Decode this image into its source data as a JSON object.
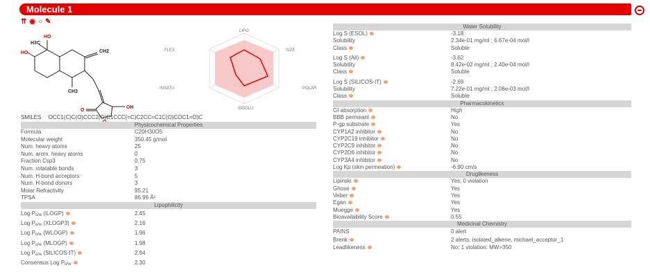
{
  "title": "Molecule 1",
  "toolbar": {
    "icons": [
      "hydrogens-icon",
      "eye-icon",
      "ring-icon",
      "eraser-icon"
    ]
  },
  "radar_labels": {
    "lipo": "LIPO",
    "size": "SIZE",
    "polar": "POLAR",
    "insolu": "INSOLU",
    "insatu": "INSATU",
    "flex": "FLEX"
  },
  "structure_labels": [
    "HO",
    "H3C",
    "HO",
    "CH3",
    "CH2",
    "O",
    "O",
    "OH"
  ],
  "smiles": {
    "label": "SMILES",
    "value": "OCC1(C)C(O)CCC2(C)C1CCC(=C)C2CC=C1C(O)COC1=O)C"
  },
  "physchem": {
    "header": "Physicochemical Properties",
    "rows": [
      {
        "k": "Formula",
        "v": "C20H30O5"
      },
      {
        "k": "Molecular weight",
        "v": "350.45 g/mol"
      },
      {
        "k": "Num. heavy atoms",
        "v": "25"
      },
      {
        "k": "Num. arom. heavy atoms",
        "v": "0"
      },
      {
        "k": "Fraction Csp3",
        "v": "0.75"
      },
      {
        "k": "Num. rotatable bonds",
        "v": "3"
      },
      {
        "k": "Num. H-bond acceptors",
        "v": "5"
      },
      {
        "k": "Num. H-bond donors",
        "v": "3"
      },
      {
        "k": "Molar Refractivity",
        "v": "95.21"
      },
      {
        "k": "TPSA",
        "v": "86.99 Å²"
      }
    ]
  },
  "lipophilicity": {
    "header": "Lipophilicity",
    "rows": [
      {
        "k": "Log P",
        "sub": "o/w",
        "suffix": " (iLOGP)",
        "v": "2.45"
      },
      {
        "k": "Log P",
        "sub": "o/w",
        "suffix": " (XLOGP3)",
        "v": "2.16"
      },
      {
        "k": "Log P",
        "sub": "o/w",
        "suffix": " (WLOGP)",
        "v": "1.96"
      },
      {
        "k": "Log P",
        "sub": "o/w",
        "suffix": " (MLOGP)",
        "v": "1.98"
      },
      {
        "k": "Log P",
        "sub": "o/w",
        "suffix": " (SILICOS-IT)",
        "v": "2.94"
      },
      {
        "k": "Consensus Log P",
        "sub": "o/w",
        "suffix": "",
        "v": "2.30"
      }
    ]
  },
  "water_solubility": {
    "header": "Water Solubility",
    "groups": [
      {
        "rows": [
          {
            "k": "Log S (ESOL)",
            "v": "-3.18",
            "dot": true
          },
          {
            "k": "Solubility",
            "v": "2.34e-01 mg/ml ; 6.67e-04 mol/l"
          },
          {
            "k": "Class",
            "v": "Soluble",
            "dot": true
          }
        ]
      },
      {
        "rows": [
          {
            "k": "Log S (Ali)",
            "v": "-3.62",
            "dot": true
          },
          {
            "k": "Solubility",
            "v": "8.42e-02 mg/ml ; 2.40e-04 mol/l"
          },
          {
            "k": "Class",
            "v": "Soluble",
            "dot": true
          }
        ]
      },
      {
        "rows": [
          {
            "k": "Log S (SILICOS-IT)",
            "v": "-2.69",
            "dot": true
          },
          {
            "k": "Solubility",
            "v": "7.22e-01 mg/ml ; 2.06e-03 mol/l"
          },
          {
            "k": "Class",
            "v": "Soluble",
            "dot": true
          }
        ]
      }
    ]
  },
  "pharmacokinetics": {
    "header": "Pharmacokinetics",
    "rows": [
      {
        "k": "GI absorption",
        "v": "High"
      },
      {
        "k": "BBB permeant",
        "v": "No"
      },
      {
        "k": "P-gp substrate",
        "v": "Yes"
      },
      {
        "k": "CYP1A2 inhibitor",
        "v": "No"
      },
      {
        "k": "CYP2C19 inhibitor",
        "v": "No"
      },
      {
        "k": "CYP2C9 inhibitor",
        "v": "No"
      },
      {
        "k": "CYP2D6 inhibitor",
        "v": "No"
      },
      {
        "k": "CYP3A4 inhibitor",
        "v": "No"
      },
      {
        "k": "Log Kp (skin permeation)",
        "v": "-6.90 cm/s"
      }
    ]
  },
  "druglikeness": {
    "header": "Druglikeness",
    "rows": [
      {
        "k": "Lipinski",
        "v": "Yes; 0 violation"
      },
      {
        "k": "Ghose",
        "v": "Yes"
      },
      {
        "k": "Veber",
        "v": "Yes"
      },
      {
        "k": "Egan",
        "v": "Yes"
      },
      {
        "k": "Muegge",
        "v": "Yes"
      },
      {
        "k": "Bioavailability Score",
        "v": "0.55"
      }
    ]
  },
  "medchem": {
    "header": "Medicinal Chemistry",
    "rows": [
      {
        "k": "PAINS",
        "v": "0 alert"
      },
      {
        "k": "Brenk",
        "v": "2 alerts: isolated_alkene, michael_acceptor_1"
      },
      {
        "k": "Leadlikeness",
        "v": "No; 1 violation: MW>350"
      }
    ]
  },
  "colors": {
    "accent": "#e50000",
    "section_header": "#d6d6d6",
    "info_dot": "#f2a070",
    "radar_fill": "#f7c9c9"
  }
}
